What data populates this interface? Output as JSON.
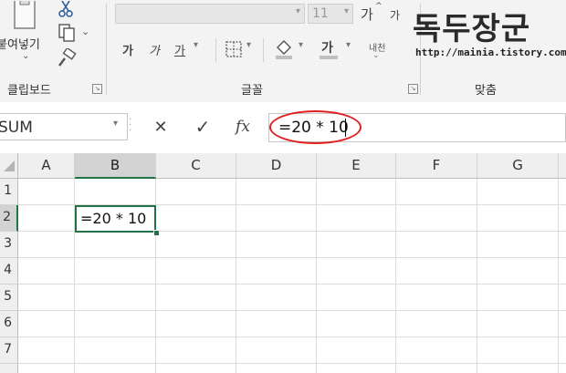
{
  "ribbon": {
    "clipboard": {
      "paste_label": "붙여넣기",
      "group_label": "클립보드"
    },
    "font": {
      "font_name_value": "",
      "font_size_value": "11",
      "grow_label": "가",
      "shrink_label": "가",
      "bold_label": "가",
      "italic_label": "가",
      "underline_label": "가",
      "font_color_label": "가",
      "hangul_label": "내천",
      "group_label": "글꼴"
    },
    "align": {
      "group_label": "맞춤"
    }
  },
  "watermark": {
    "title": "독두장군",
    "url": "http://mainia.tistory.com"
  },
  "formula_bar": {
    "name_box_value": "SUM",
    "cancel_symbol": "✕",
    "enter_symbol": "✓",
    "fx_label": "fx",
    "formula_value": "=20 * 10"
  },
  "sheet": {
    "columns": [
      "A",
      "B",
      "C",
      "D",
      "E",
      "F",
      "G"
    ],
    "rows": [
      "1",
      "2",
      "3",
      "4",
      "5",
      "6",
      "7"
    ],
    "active_cell_value": "=20 * 10"
  },
  "colors": {
    "selection_green": "#217346",
    "annotation_red": "#e02020"
  }
}
